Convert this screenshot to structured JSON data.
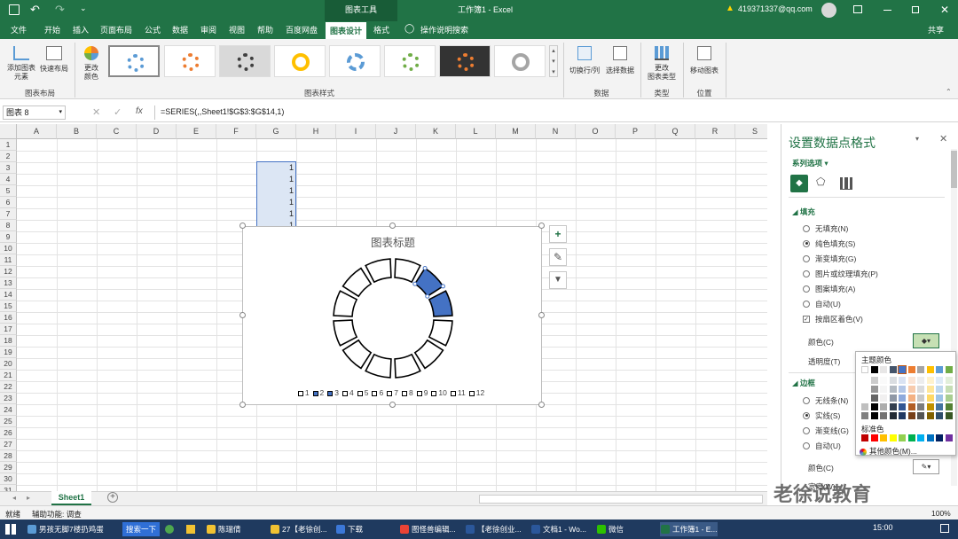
{
  "titlebar": {
    "context_tab": "图表工具",
    "title": "工作簿1 - Excel",
    "account": "419371337@qq.com"
  },
  "tabs": [
    "文件",
    "开始",
    "插入",
    "页面布局",
    "公式",
    "数据",
    "审阅",
    "视图",
    "帮助",
    "百度网盘",
    "图表设计",
    "格式"
  ],
  "active_tab": "图表设计",
  "tell_me": "操作说明搜索",
  "share": "共享",
  "ribbon": {
    "add_element": "添加图表\n元素",
    "quick_layout": "快速布局",
    "change_colors": "更改\n颜色",
    "group_layout": "图表布局",
    "group_styles": "图表样式",
    "switch_row_col": "切换行/列",
    "select_data": "选择数据",
    "group_data": "数据",
    "change_type": "更改\n图表类型",
    "group_type": "类型",
    "move_chart": "移动图表",
    "group_location": "位置"
  },
  "formula_bar": {
    "name_box": "图表 8",
    "fx": "fx",
    "formula": "=SERIES(,,Sheet1!$G$3:$G$14,1)"
  },
  "columns": [
    "A",
    "B",
    "C",
    "D",
    "E",
    "F",
    "G",
    "H",
    "I",
    "J",
    "K",
    "L",
    "M",
    "N",
    "O",
    "P",
    "Q",
    "R",
    "S"
  ],
  "rows": [
    "1",
    "2",
    "3",
    "4",
    "5",
    "6",
    "7",
    "8",
    "9",
    "10",
    "11",
    "12",
    "13",
    "14",
    "15",
    "16",
    "17",
    "18",
    "19",
    "20",
    "21",
    "22",
    "23",
    "24",
    "25",
    "26",
    "27",
    "28",
    "29",
    "30",
    "31"
  ],
  "g_values": [
    "1",
    "1",
    "1",
    "1",
    "1",
    "1",
    "1"
  ],
  "chart": {
    "title": "图表标题",
    "legend": [
      "1",
      "2",
      "3",
      "4",
      "5",
      "6",
      "7",
      "8",
      "9",
      "10",
      "11",
      "12"
    ],
    "highlight_color": "#4472c4"
  },
  "chart_data": {
    "type": "pie",
    "title": "图表标题",
    "categories": [
      "1",
      "2",
      "3",
      "4",
      "5",
      "6",
      "7",
      "8",
      "9",
      "10",
      "11",
      "12"
    ],
    "values": [
      1,
      1,
      1,
      1,
      1,
      1,
      1,
      1,
      1,
      1,
      1,
      1
    ],
    "filled": [
      false,
      true,
      true,
      false,
      false,
      false,
      false,
      false,
      false,
      false,
      false,
      false
    ]
  },
  "sheet_tab": "Sheet1",
  "status": {
    "ready": "就绪",
    "accessibility": "辅助功能: 调查",
    "zoom": "100%"
  },
  "pane": {
    "title": "设置数据点格式",
    "series_options": "系列选项",
    "fill_header": "填充",
    "fill_options": [
      "无填充(N)",
      "纯色填充(S)",
      "渐变填充(G)",
      "图片或纹理填充(P)",
      "图案填充(A)",
      "自动(U)"
    ],
    "vary_colors": "按扇区着色(V)",
    "color_label": "颜色(C)",
    "transparency_label": "透明度(T)",
    "border_header": "边框",
    "border_options": [
      "无线条(N)",
      "实线(S)",
      "渐变线(G)",
      "自动(U)"
    ],
    "border_color_label": "颜色(C)",
    "width_label": "宽度(W)"
  },
  "palette": {
    "theme_label": "主题颜色",
    "standard_label": "标准色",
    "more_colors": "其他颜色(M)...",
    "theme_top": [
      "#ffffff",
      "#000000",
      "#e7e6e6",
      "#44546a",
      "#4472c4",
      "#ed7d31",
      "#a5a5a5",
      "#ffc000",
      "#5b9bd5",
      "#70ad47"
    ],
    "standard": [
      "#c00000",
      "#ff0000",
      "#ffc000",
      "#ffff00",
      "#92d050",
      "#00b050",
      "#00b0f0",
      "#0070c0",
      "#002060",
      "#7030a0"
    ]
  },
  "watermark": "老徐说教育",
  "taskbar": {
    "search": "搜索一下",
    "news": "男孩无脚7楼扔鸡蛋",
    "items": [
      "陈瑞倩",
      "27【老徐创...",
      "下载",
      "图怪兽编辑...",
      "【老徐创业...",
      "文档1 - Wo...",
      "微信",
      "工作簿1 - E..."
    ],
    "clock": "15:00"
  }
}
